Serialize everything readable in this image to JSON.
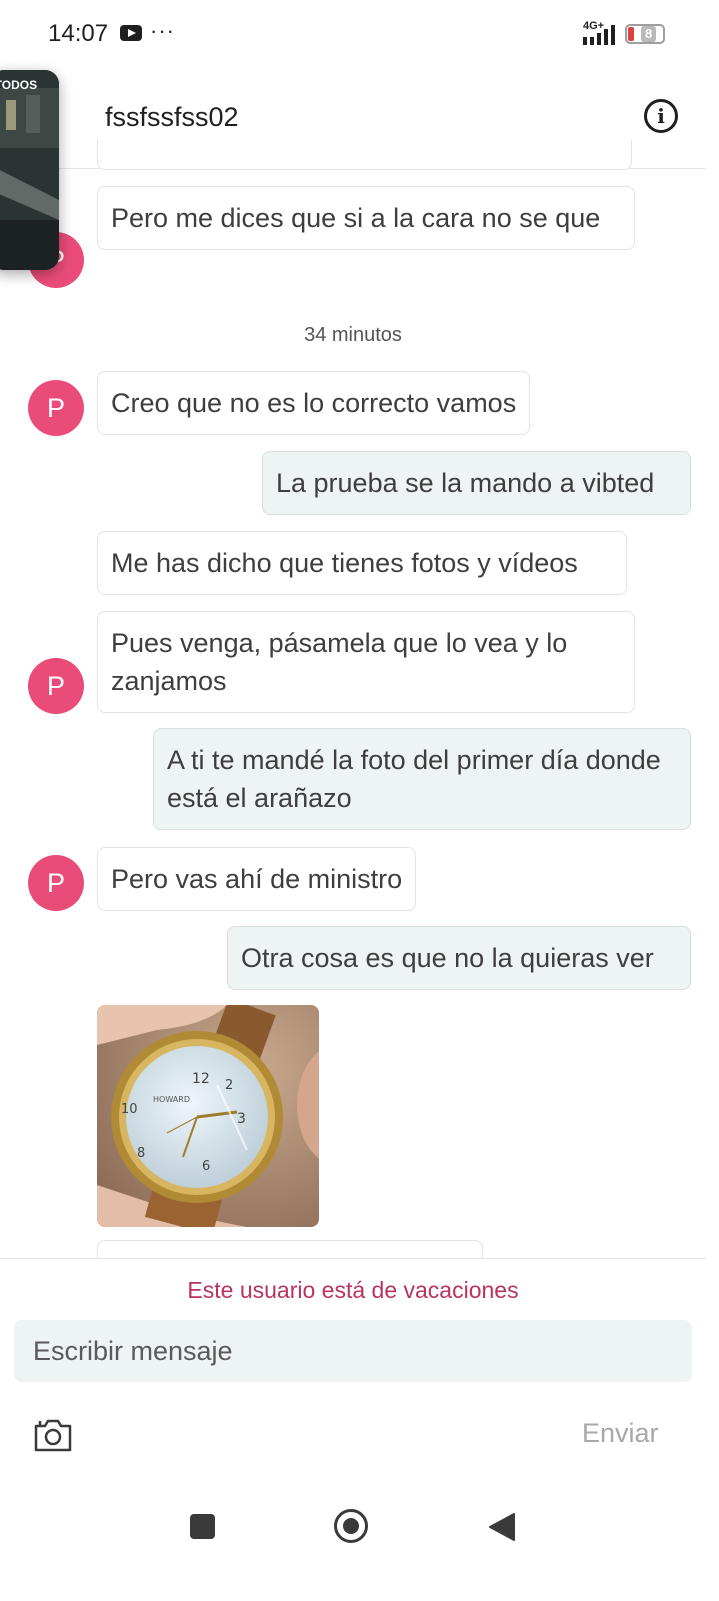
{
  "status_bar": {
    "time": "14:07",
    "network": "4G+",
    "battery": "8"
  },
  "overlay": {
    "label": "UTODOS"
  },
  "header": {
    "contact_name": "fssfssfss02"
  },
  "messages": [
    {
      "direction": "in",
      "avatar": "P",
      "text": "Pero me dices que si a la cara no se que"
    },
    {
      "type": "timestamp",
      "text": "34 minutos"
    },
    {
      "direction": "in",
      "avatar": "P",
      "text": "Creo que no es lo correcto vamos"
    },
    {
      "direction": "out",
      "text": "La prueba se la mando a vibted"
    },
    {
      "direction": "in",
      "text": "Me has dicho que tienes fotos y vídeos"
    },
    {
      "direction": "in",
      "avatar": "P",
      "text": "Pues venga, pásamela que lo vea y lo zanjamos"
    },
    {
      "direction": "out",
      "text": "A ti te mandé la foto del primer día donde está el arañazo"
    },
    {
      "direction": "in",
      "avatar": "P",
      "text": "Pero vas ahí de ministro"
    },
    {
      "direction": "out",
      "text": "Otra cosa es que no la quieras ver"
    },
    {
      "direction": "in",
      "type": "image",
      "image": "wristwatch-photo",
      "watch_brand": "HOWARD"
    }
  ],
  "footer": {
    "notice": "Este usuario está de vacaciones",
    "input_placeholder": "Escribir mensaje",
    "send_label": "Enviar"
  },
  "colors": {
    "avatar": "#ea4c7a",
    "notice": "#b8345d",
    "outgoing_bubble": "#eef3f3"
  }
}
